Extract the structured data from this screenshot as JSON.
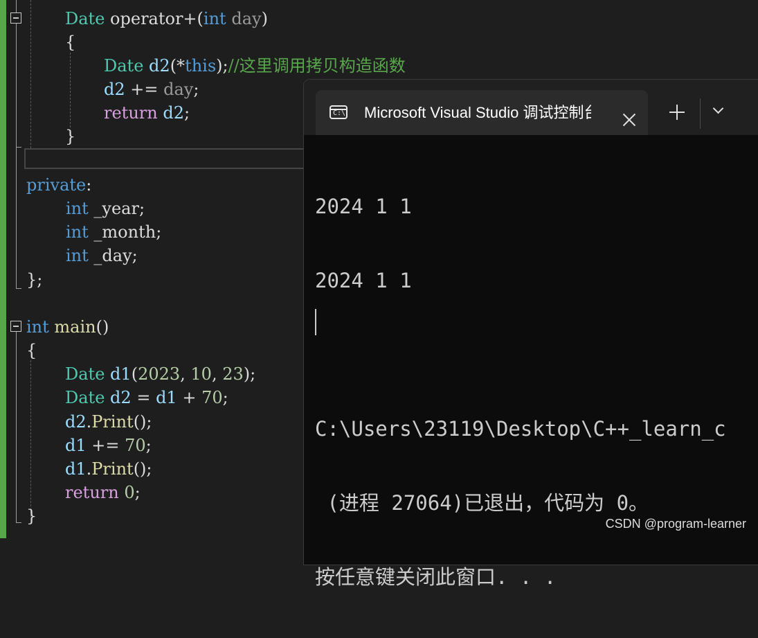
{
  "editor": {
    "lines": [
      {
        "t1": "Date",
        "t2": " ",
        "t3": "operator+",
        "t4": "(",
        "t5": "int",
        "t6": " ",
        "t7": "day",
        "t8": ")"
      },
      {
        "t1": "{"
      },
      {
        "t1": "Date",
        "t2": " ",
        "t3": "d2",
        "t4": "(*",
        "t5": "this",
        "t6": ");",
        "t7": "//这里调用拷贝构造函数"
      },
      {
        "t1": "d2",
        "t2": " += ",
        "t3": "day",
        "t4": ";"
      },
      {
        "t1": "return",
        "t2": " ",
        "t3": "d2",
        "t4": ";"
      },
      {
        "t1": "}"
      },
      {
        "t1": "private",
        "t2": ":"
      },
      {
        "t1": "int",
        "t2": " ",
        "t3": "_year",
        "t4": ";"
      },
      {
        "t1": "int",
        "t2": " ",
        "t3": "_month",
        "t4": ";"
      },
      {
        "t1": "int",
        "t2": " ",
        "t3": "_day",
        "t4": ";"
      },
      {
        "t1": "};"
      },
      {
        "t1": "int",
        "t2": " ",
        "t3": "main",
        "t4": "()"
      },
      {
        "t1": "{"
      },
      {
        "t1": "Date",
        "t2": " ",
        "t3": "d1",
        "t4": "(",
        "t5": "2023",
        "t6": ", ",
        "t7": "10",
        "t8": ", ",
        "t9": "23",
        "t10": ");"
      },
      {
        "t1": "Date",
        "t2": " ",
        "t3": "d2",
        "t4": " = ",
        "t5": "d1",
        "t6": " + ",
        "t7": "70",
        "t8": ";"
      },
      {
        "t1": "d2",
        "t2": ".",
        "t3": "Print",
        "t4": "();"
      },
      {
        "t1": "d1",
        "t2": " += ",
        "t3": "70",
        "t4": ";"
      },
      {
        "t1": "d1",
        "t2": ".",
        "t3": "Print",
        "t4": "();"
      },
      {
        "t1": "return",
        "t2": " ",
        "t3": "0",
        "t4": ";"
      },
      {
        "t1": "}"
      }
    ]
  },
  "terminal": {
    "tab_title": "Microsoft Visual Studio 调试控制台",
    "icons": {
      "tab": "terminal-icon",
      "close": "close-icon",
      "new_tab": "plus-icon",
      "dropdown": "chevron-down-icon"
    },
    "output": [
      "2024 1 1",
      "2024 1 1",
      "",
      "C:\\Users\\23119\\Desktop\\C++_learn_c",
      " (进程 27064)已退出，代码为 0。",
      "按任意键关闭此窗口. . ."
    ]
  },
  "watermark": "CSDN @program-learner",
  "colors": {
    "type": "#4ec9b0",
    "keyword": "#569cd6",
    "function": "#dcdcaa",
    "variable": "#9cdcfe",
    "comment": "#57a64a",
    "control": "#d8a0df",
    "number": "#b5cea8",
    "editor_bg": "#1e1e1e",
    "terminal_bg": "#0c0c0c",
    "titlebar_bg": "#202020",
    "tab_bg": "#2b2b2b"
  }
}
